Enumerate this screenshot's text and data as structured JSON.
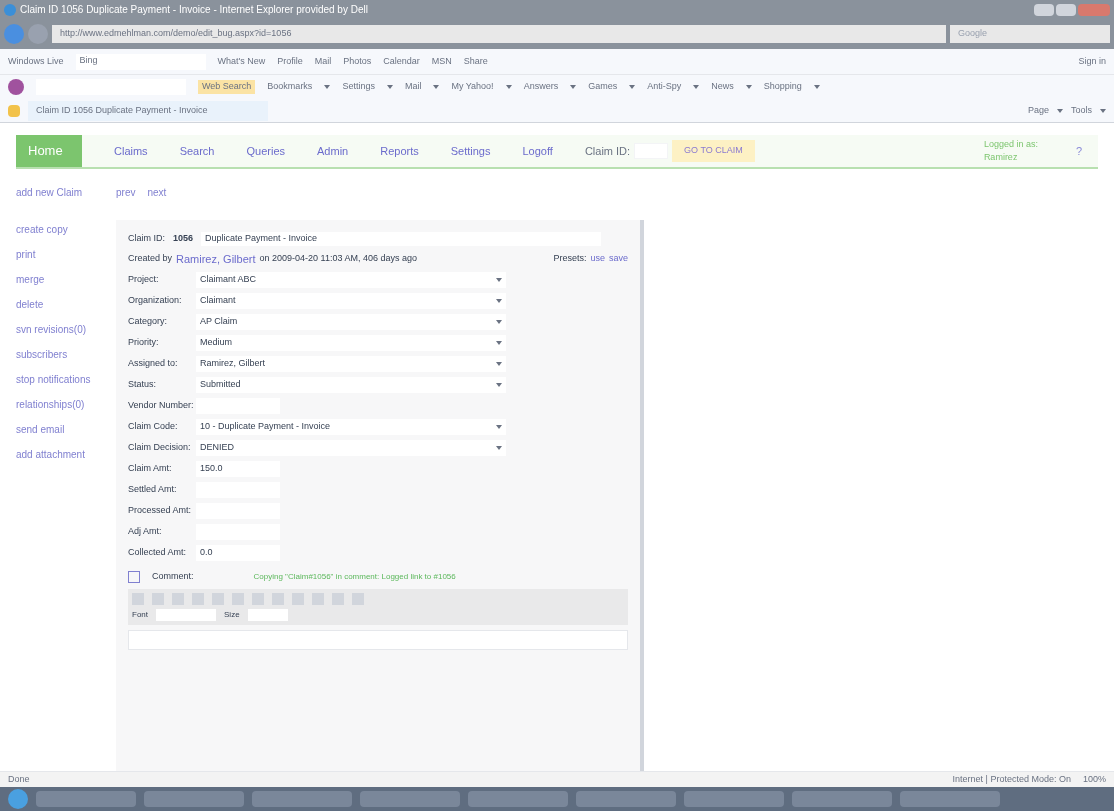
{
  "window": {
    "title": "Claim ID 1056 Duplicate Payment - Invoice - Internet Explorer provided by Dell"
  },
  "address_bar": {
    "url": "http://www.edmehlman.com/demo/edit_bug.aspx?id=1056",
    "search_placeholder": "Google"
  },
  "live_toolbar": {
    "brand": "Windows Live",
    "search_placeholder": "Bing",
    "links": [
      "What's New",
      "Profile",
      "Mail",
      "Photos",
      "Calendar",
      "MSN",
      "Share"
    ],
    "sign_in": "Sign in"
  },
  "yahoo_toolbar": {
    "search_button": "Web Search",
    "items": [
      "Bookmarks",
      "Settings",
      "Mail",
      "My Yahoo!",
      "Answers",
      "Games",
      "Anti-Spy",
      "News",
      "Shopping"
    ]
  },
  "tab": {
    "title": "Claim ID 1056 Duplicate Payment - Invoice"
  },
  "command_bar": [
    "Page",
    "Tools"
  ],
  "nav": {
    "items": [
      {
        "label": "Home",
        "selected": true
      },
      {
        "label": "Claims",
        "selected": false
      },
      {
        "label": "Search",
        "selected": false
      },
      {
        "label": "Queries",
        "selected": false
      },
      {
        "label": "Admin",
        "selected": false
      },
      {
        "label": "Reports",
        "selected": false
      },
      {
        "label": "Settings",
        "selected": false
      },
      {
        "label": "Logoff",
        "selected": false
      }
    ],
    "claim_id_label": "Claim ID:",
    "go_button": "GO TO CLAIM",
    "logged_in": "Logged in as: Ramirez",
    "help": "?"
  },
  "sidebar": {
    "items": [
      "add new Claim",
      "create copy",
      "print",
      "merge",
      "delete",
      "svn revisions(0)",
      "subscribers",
      "stop notifications",
      "relationships(0)",
      "send email",
      "add attachment"
    ]
  },
  "pager": [
    "prev",
    "next"
  ],
  "claim": {
    "id_label": "Claim ID:",
    "id": "1056",
    "summary": "Duplicate Payment - Invoice",
    "created_prefix": "Created by",
    "creator": "Ramirez, Gilbert",
    "created_suffix": "on 2009-04-20 11:03 AM, 406 days ago",
    "presets_label": "Presets:",
    "presets": [
      "use",
      "save"
    ]
  },
  "fields": [
    {
      "kind": "select",
      "label": "Project:",
      "value": "Claimant ABC"
    },
    {
      "kind": "select",
      "label": "Organization:",
      "value": "Claimant"
    },
    {
      "kind": "select",
      "label": "Category:",
      "value": "AP Claim"
    },
    {
      "kind": "select",
      "label": "Priority:",
      "value": "Medium"
    },
    {
      "kind": "select",
      "label": "Assigned to:",
      "value": "Ramirez, Gilbert"
    },
    {
      "kind": "select",
      "label": "Status:",
      "value": "Submitted"
    },
    {
      "kind": "text",
      "label": "Vendor Number:"
    },
    {
      "kind": "select",
      "label": "Claim Code:",
      "value": "10 - Duplicate Payment - Invoice"
    },
    {
      "kind": "select",
      "label": "Claim Decision:",
      "value": "DENIED"
    },
    {
      "kind": "text",
      "label": "Claim Amt:",
      "value": "150.0"
    },
    {
      "kind": "text",
      "label": "Settled Amt:"
    },
    {
      "kind": "text",
      "label": "Processed Amt:"
    },
    {
      "kind": "text",
      "label": "Adj Amt:"
    },
    {
      "kind": "text",
      "label": "Collected Amt:",
      "value": "0.0"
    }
  ],
  "comment": {
    "label": "Comment:",
    "notice": "Copying \"Claim#1056\" in comment: Logged link to #1056",
    "font_label": "Font",
    "size_label": "Size"
  },
  "status_bar": {
    "text": "Done",
    "zone": "Internet | Protected Mode: On",
    "zoom": "100%"
  }
}
